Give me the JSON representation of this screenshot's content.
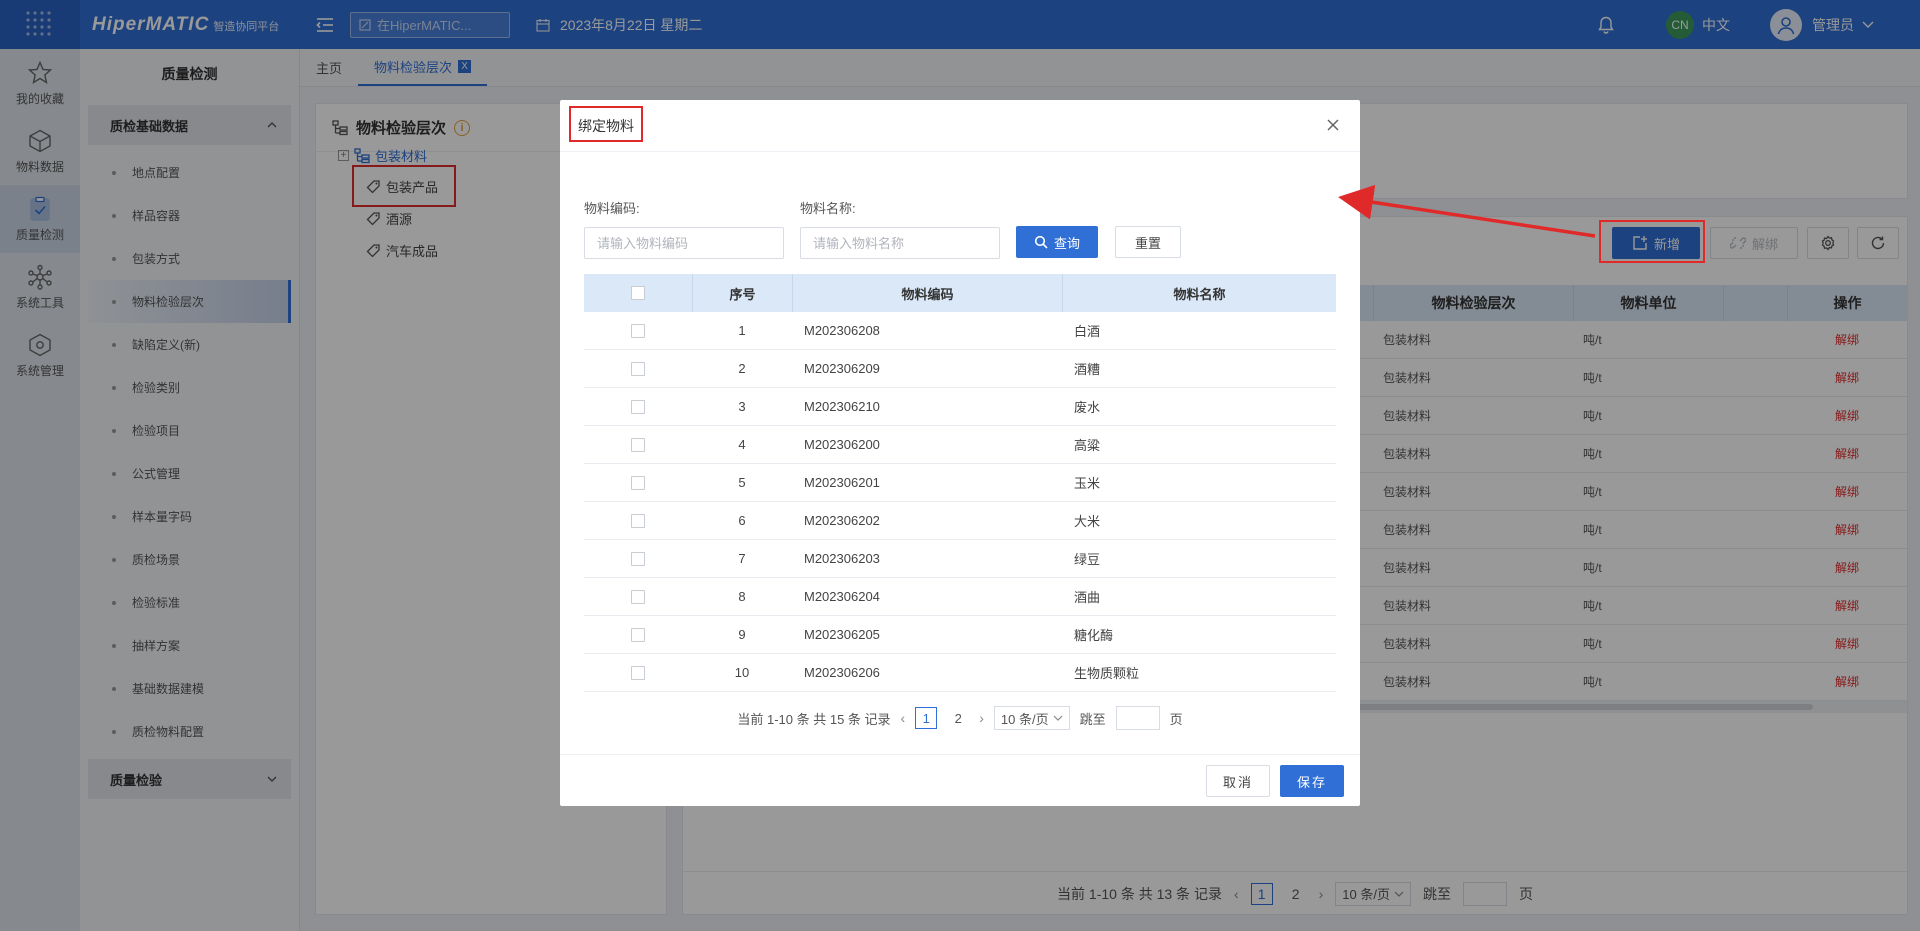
{
  "header": {
    "brand": "HiperMATIC",
    "brand_sub": "智造协同平台",
    "search_placeholder": "在HiperMATIC...",
    "date": "2023年8月22日 星期二",
    "lang_badge": "CN",
    "lang_label": "中文",
    "user_name": "管理员"
  },
  "rail": {
    "items": [
      {
        "label": "我的收藏",
        "icon": "star-icon"
      },
      {
        "label": "物料数据",
        "icon": "cube-icon"
      },
      {
        "label": "质量检测",
        "icon": "clipboard-icon"
      },
      {
        "label": "系统工具",
        "icon": "network-icon"
      },
      {
        "label": "系统管理",
        "icon": "settings-cube-icon"
      }
    ]
  },
  "submenu": {
    "title": "质量检测",
    "group1": "质检基础数据",
    "items": [
      "地点配置",
      "样品容器",
      "包装方式",
      "物料检验层次",
      "缺陷定义(新)",
      "检验类别",
      "检验项目",
      "公式管理",
      "样本量字码",
      "质检场景",
      "检验标准",
      "抽样方案",
      "基础数据建模",
      "质检物料配置"
    ],
    "group2": "质量检验"
  },
  "tabs": {
    "home": "主页",
    "current": "物料检验层次",
    "close": "X"
  },
  "tree": {
    "title": "物料检验层次",
    "root": "包装材料",
    "children": [
      "包装产品",
      "酒源",
      "汽车成品"
    ]
  },
  "toolbar": {
    "add": "新增",
    "unbind": "解绑"
  },
  "bg_table": {
    "col_level": "物料检验层次",
    "col_unit": "物料单位",
    "col_op": "操作",
    "row_level": "包装材料",
    "row_unit": "吨/t",
    "row_op": "解绑"
  },
  "bg_pager": {
    "summary": "当前 1-10 条 共 13 条 记录",
    "pages": [
      "1",
      "2"
    ],
    "size": "10 条/页",
    "jump": "跳至",
    "page_unit": "页"
  },
  "modal": {
    "title": "绑定物料",
    "code_label": "物料编码:",
    "code_placeholder": "请输入物料编码",
    "name_label": "物料名称:",
    "name_placeholder": "请输入物料名称",
    "query": "查询",
    "reset": "重置",
    "col_idx": "序号",
    "col_code": "物料编码",
    "col_name": "物料名称",
    "rows": [
      {
        "idx": "1",
        "code": "M202306208",
        "name": "白酒"
      },
      {
        "idx": "2",
        "code": "M202306209",
        "name": "酒糟"
      },
      {
        "idx": "3",
        "code": "M202306210",
        "name": "废水"
      },
      {
        "idx": "4",
        "code": "M202306200",
        "name": "高粱"
      },
      {
        "idx": "5",
        "code": "M202306201",
        "name": "玉米"
      },
      {
        "idx": "6",
        "code": "M202306202",
        "name": "大米"
      },
      {
        "idx": "7",
        "code": "M202306203",
        "name": "绿豆"
      },
      {
        "idx": "8",
        "code": "M202306204",
        "name": "酒曲"
      },
      {
        "idx": "9",
        "code": "M202306205",
        "name": "糖化酶"
      },
      {
        "idx": "10",
        "code": "M202306206",
        "name": "生物质颗粒"
      }
    ],
    "pager_summary": "当前 1-10 条 共 15 条 记录",
    "pages": [
      "1",
      "2"
    ],
    "size": "10 条/页",
    "jump": "跳至",
    "page_unit": "页",
    "cancel": "取消",
    "save": "保存"
  },
  "colors": {
    "primary": "#2f6fd6",
    "annotation": "#e02a2a",
    "danger": "#e02a2a"
  }
}
